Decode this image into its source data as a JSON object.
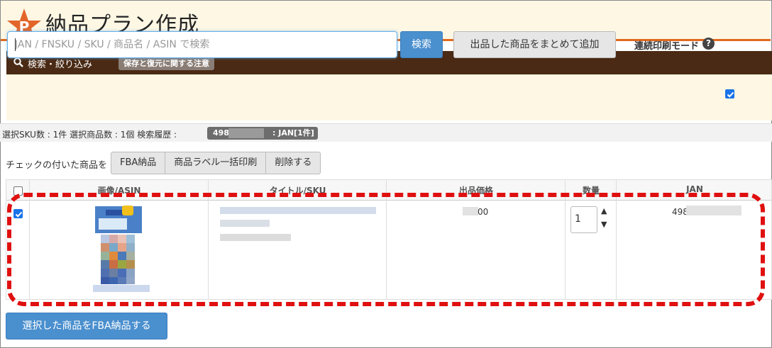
{
  "header": {
    "title": "納品プラン作成",
    "logo_letter": "P"
  },
  "search_panel": {
    "title": "検索・絞り込み",
    "note_badge": "保存と復元に関する注意",
    "placeholder": "JAN / FNSKU / SKU / 商品名 / ASIN で検索",
    "search_button": "検索",
    "bulk_add_button": "出品した商品をまとめて追加",
    "continuous_print_label": "連続印刷モード",
    "continuous_print_checked": true
  },
  "status": {
    "summary": "選択SKU数 : 1件 選択商品数 : 1個  検索履歴 :",
    "history_code": "498",
    "history_jan": ": JAN[1件]"
  },
  "actions": {
    "label": "チェックの付いた商品を",
    "buttons": [
      "FBA納品",
      "商品ラベル一括印刷",
      "削除する"
    ]
  },
  "table": {
    "headers": [
      "画像/ASIN",
      "タイトル/SKU",
      "出品価格",
      "数量",
      "JAN"
    ],
    "rows": [
      {
        "checked": true,
        "price_suffix": "00",
        "quantity": "1",
        "jan_prefix": "498"
      }
    ]
  },
  "submit_button": "選択した商品をFBA納品する",
  "colors": {
    "accent": "#e0691e",
    "panel_head": "#4a2a14",
    "primary": "#4a8fce",
    "highlight": "#e01010"
  }
}
